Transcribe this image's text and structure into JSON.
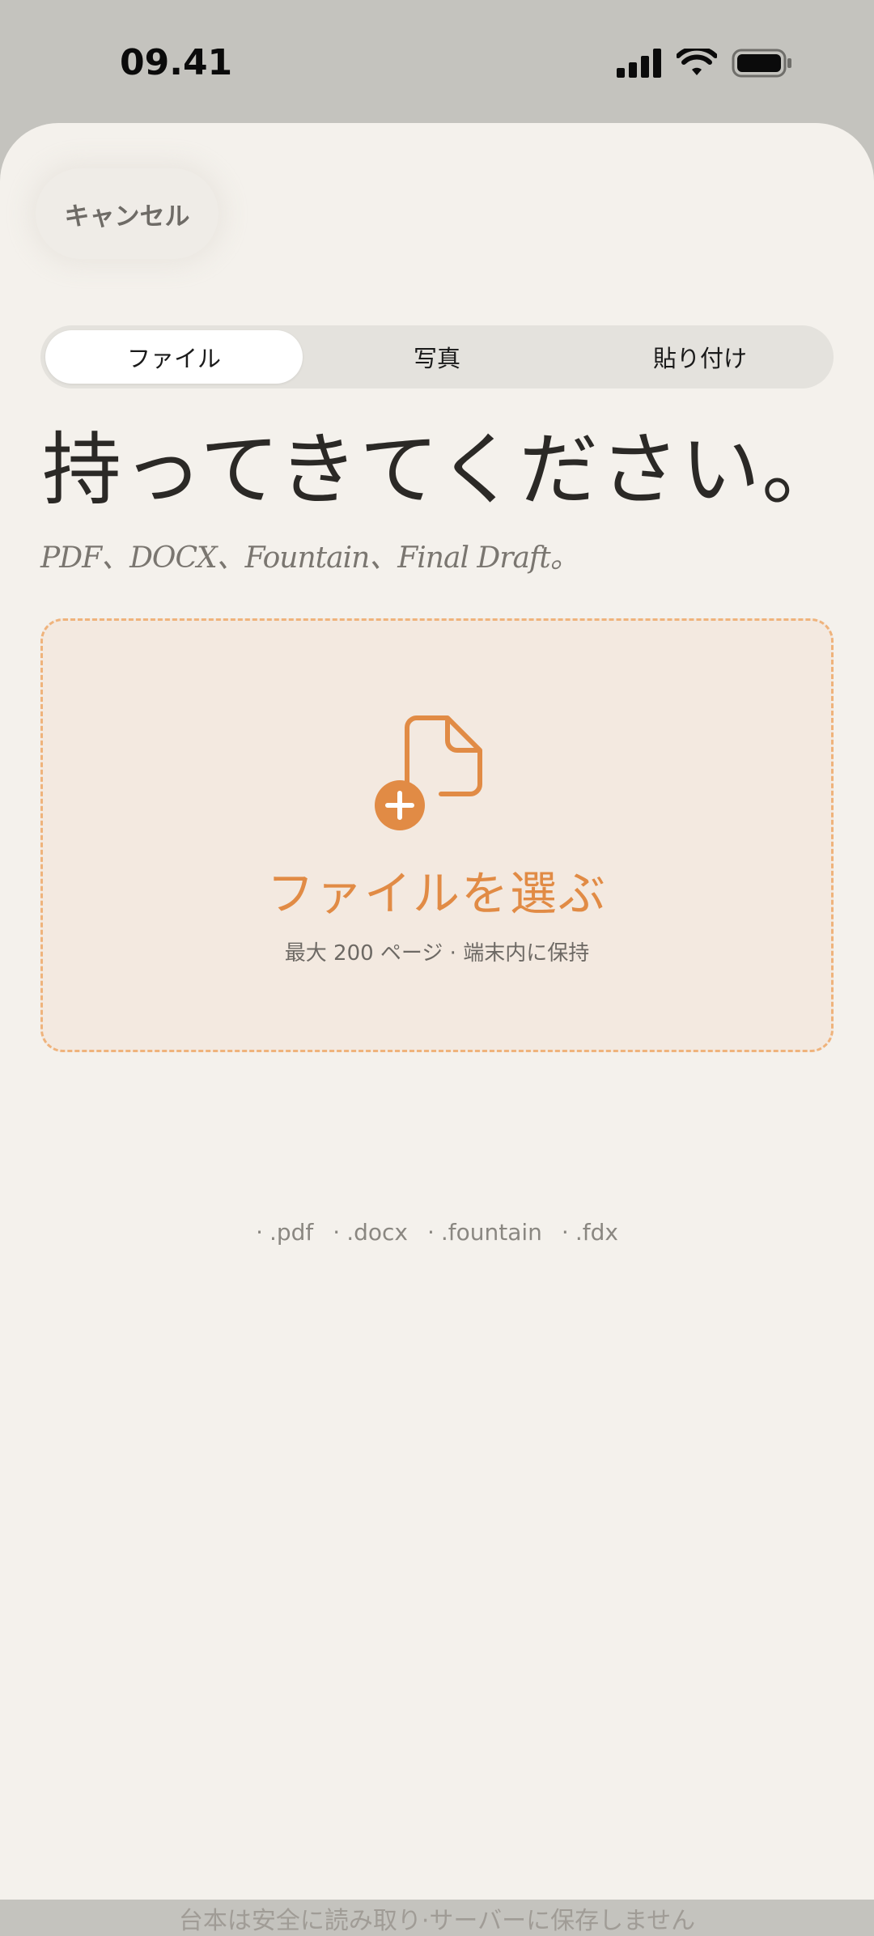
{
  "status_bar": {
    "time": "09.41"
  },
  "sheet": {
    "cancel_label": "キャンセル",
    "tabs": [
      {
        "label": "ファイル",
        "active": true
      },
      {
        "label": "写真",
        "active": false
      },
      {
        "label": "貼り付け",
        "active": false
      }
    ],
    "headline": "持ってきてください。",
    "subhead": "PDF、DOCX、Fountain、Final Draft。",
    "drop_zone": {
      "icon": "file-add-icon",
      "title": "ファイルを選ぶ",
      "subtitle": "最大 200 ページ · 端末内に保持"
    },
    "extensions": [
      {
        "dot": "·",
        "label": ".pdf"
      },
      {
        "dot": "·",
        "label": ".docx"
      },
      {
        "dot": "·",
        "label": ".fountain"
      },
      {
        "dot": "·",
        "label": ".fdx"
      }
    ],
    "footer_note": "台本は安全に読み取り·サーバーに保存しません"
  },
  "colors": {
    "accent": "#e18b45",
    "dashed_border": "#efb37c",
    "sheet_bg": "#f4f1ec",
    "drop_bg": "#f3e9e0"
  }
}
